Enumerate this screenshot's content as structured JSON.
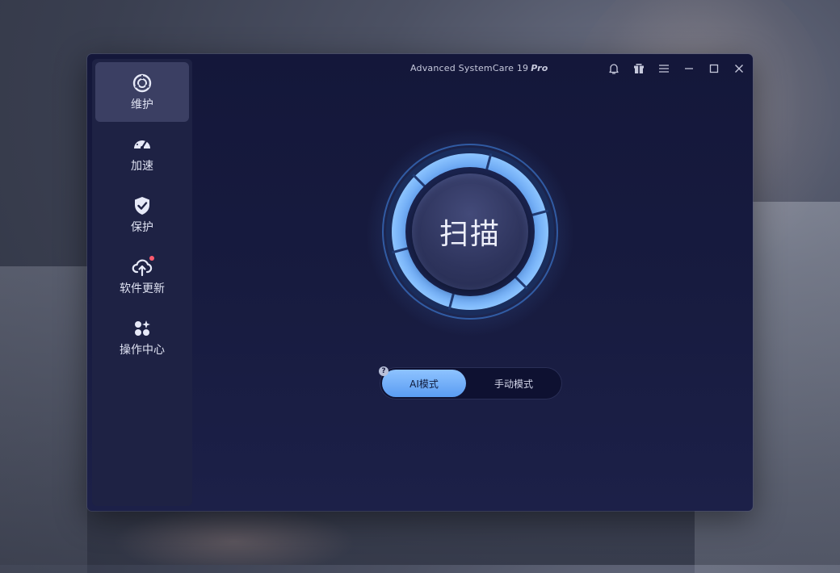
{
  "window": {
    "title": "Advanced SystemCare 19",
    "edition": "Pro"
  },
  "titlebar": {
    "buttons": [
      {
        "id": "notifications",
        "icon": "bell-icon"
      },
      {
        "id": "gift",
        "icon": "gift-box-icon"
      },
      {
        "id": "menu",
        "icon": "hamburger-menu-icon"
      },
      {
        "id": "minimize",
        "icon": "minimize-icon"
      },
      {
        "id": "maximize",
        "icon": "maximize-icon"
      },
      {
        "id": "close",
        "icon": "close-icon"
      }
    ]
  },
  "sidebar": {
    "items": [
      {
        "label": "维护",
        "icon": "maintenance-icon",
        "active": true
      },
      {
        "label": "加速",
        "icon": "speedometer-icon",
        "active": false
      },
      {
        "label": "保护",
        "icon": "shield-check-icon",
        "active": false
      },
      {
        "label": "软件更新",
        "icon": "cloud-upload-icon",
        "active": false,
        "badge": true
      },
      {
        "label": "操作中心",
        "icon": "apps-grid-icon",
        "active": false
      }
    ]
  },
  "main": {
    "scan_label": "扫描",
    "modes": {
      "help": "?",
      "ai_label": "AI模式",
      "manual_label": "手动模式",
      "selected": "AI模式"
    }
  },
  "colors": {
    "accent": "#5a9cf2",
    "window_bg": "#14173a",
    "sidebar_bg": "#1e2244",
    "active_item_bg": "#3b3f63",
    "badge": "#ff5a6e"
  }
}
